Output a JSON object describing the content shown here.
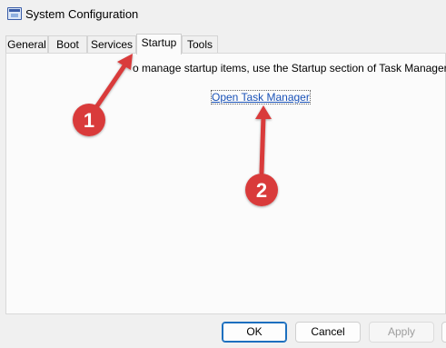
{
  "window": {
    "title": "System Configuration"
  },
  "tabs": [
    {
      "label": "General"
    },
    {
      "label": "Boot"
    },
    {
      "label": "Services"
    },
    {
      "label": "Startup"
    },
    {
      "label": "Tools"
    }
  ],
  "active_tab": "Startup",
  "content": {
    "message": "o manage startup items, use the Startup section of Task Manager.",
    "link": "Open Task Manager"
  },
  "buttons": {
    "ok": "OK",
    "cancel": "Cancel",
    "apply": "Apply"
  },
  "annotations": {
    "step1": "1",
    "step2": "2",
    "color": "#d93a3a"
  }
}
